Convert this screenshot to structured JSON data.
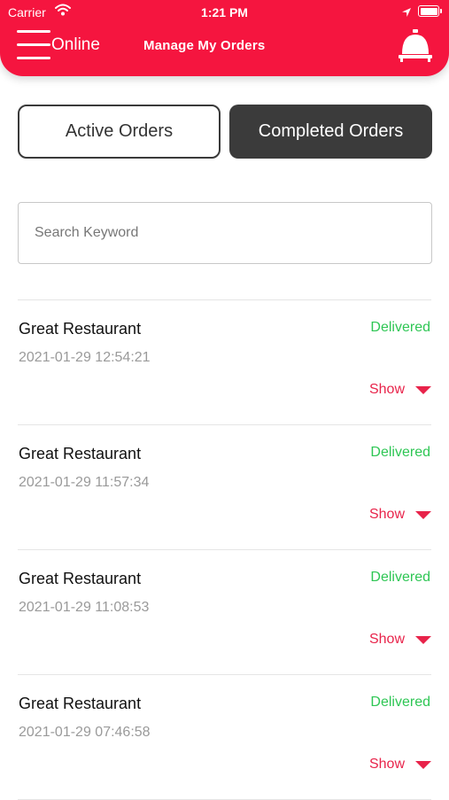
{
  "status_bar": {
    "carrier": "Carrier",
    "time": "1:21 PM"
  },
  "header": {
    "status_label": "Online",
    "title": "Manage My Orders",
    "menu_icon": "hamburger-menu-icon",
    "bell_icon": "service-bell-icon",
    "color": "#f5153f"
  },
  "tabs": [
    {
      "label": "Active Orders",
      "selected": false
    },
    {
      "label": "Completed Orders",
      "selected": true
    }
  ],
  "search": {
    "placeholder": "Search Keyword",
    "value": ""
  },
  "orders": [
    {
      "restaurant": "Great Restaurant",
      "datetime": "2021-01-29 12:54:21",
      "status": "Delivered",
      "action": "Show"
    },
    {
      "restaurant": "Great Restaurant",
      "datetime": "2021-01-29 11:57:34",
      "status": "Delivered",
      "action": "Show"
    },
    {
      "restaurant": "Great Restaurant",
      "datetime": "2021-01-29 11:08:53",
      "status": "Delivered",
      "action": "Show"
    },
    {
      "restaurant": "Great Restaurant",
      "datetime": "2021-01-29 07:46:58",
      "status": "Delivered",
      "action": "Show"
    }
  ],
  "colors": {
    "status_delivered": "#2ec654",
    "accent": "#e8234a",
    "dark_tab": "#3b3b3b"
  }
}
